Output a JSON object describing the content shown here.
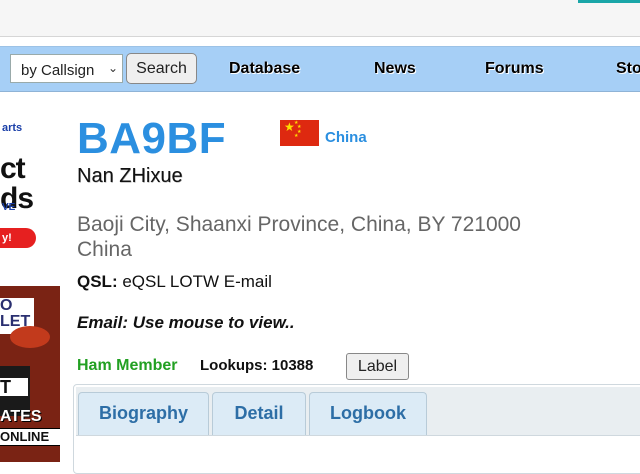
{
  "search": {
    "type_selected": "by Callsign",
    "button_label": "Search"
  },
  "nav": {
    "items": [
      "Database",
      "News",
      "Forums",
      "Sto"
    ]
  },
  "ads": {
    "top": {
      "line1": "arts",
      "line2": "ct\nds",
      "line3": "VE",
      "button": "y!"
    },
    "bottom": {
      "line1": "O\nLET",
      "line2": "T",
      "line3": "ATES",
      "line4": "ONLINE"
    }
  },
  "profile": {
    "callsign": "BA9BF",
    "country": "China",
    "name": "Nan ZHixue",
    "address_line1": "Baoji City, Shaanxi Province, China, BY 721000",
    "address_line2": "China",
    "qsl_label": "QSL:",
    "qsl_value": "eQSL LOTW E-mail",
    "email_text": "Email: Use mouse to view..",
    "member_status": "Ham Member",
    "lookups": "Lookups: 10388",
    "label_button": "Label"
  },
  "tabs": [
    "Biography",
    "Detail",
    "Logbook"
  ],
  "colors": {
    "navbar": "#a6cff6",
    "callsign": "#2b8fe0",
    "member": "#22a022",
    "tab_text": "#2d6ea6"
  }
}
